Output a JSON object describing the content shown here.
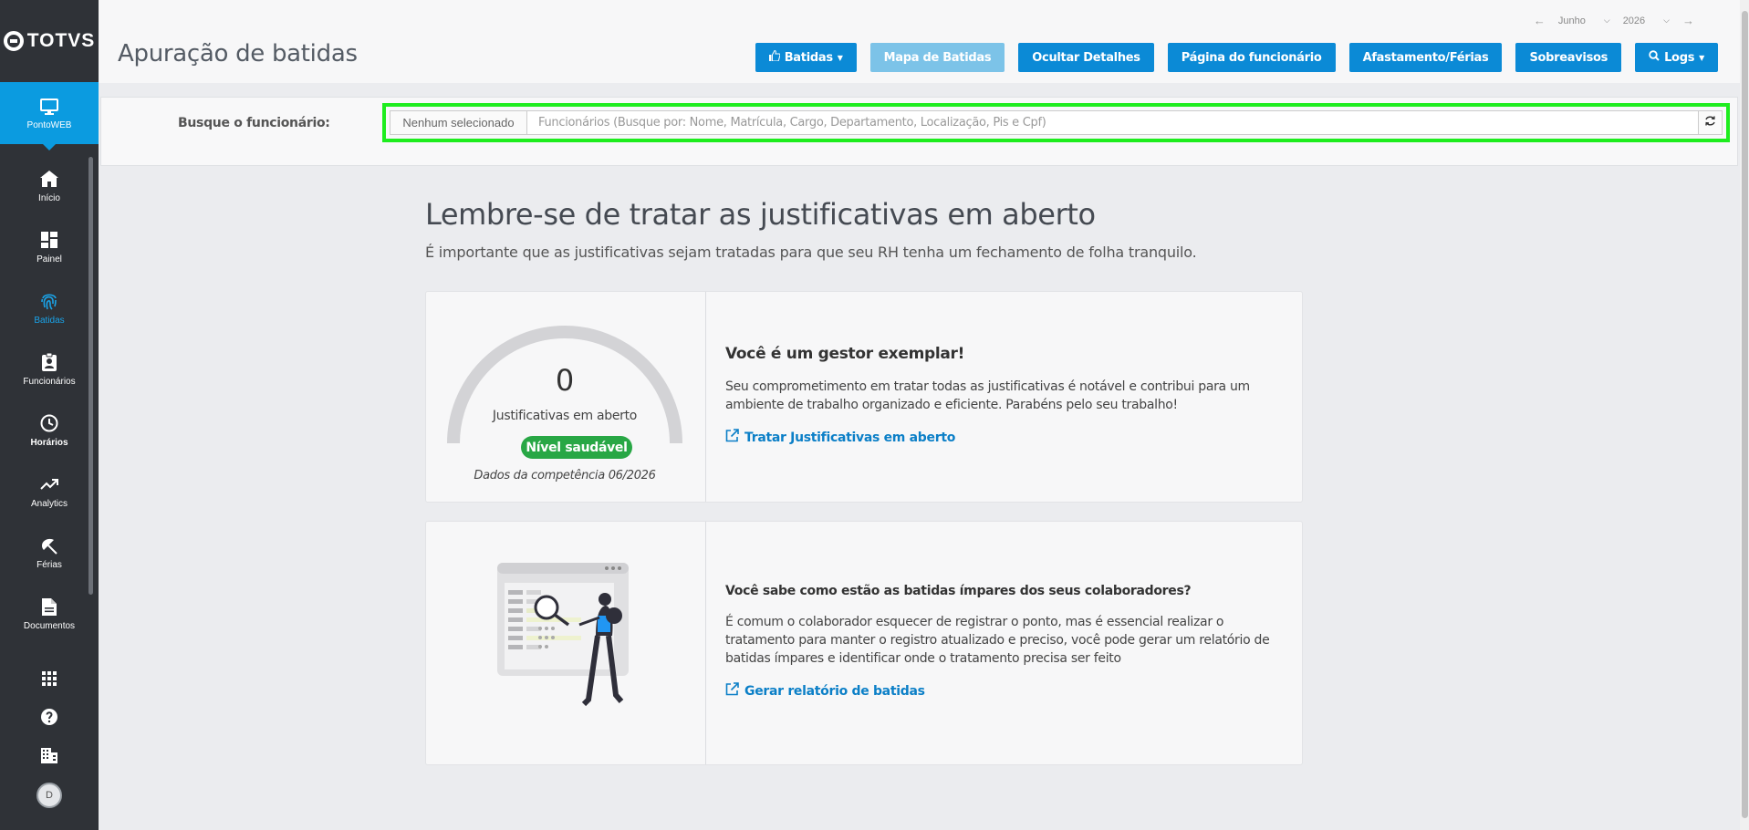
{
  "brand": {
    "name": "TOTVS"
  },
  "sidebar": {
    "app": {
      "label": "PontoWEB",
      "icon": "monitor-icon"
    },
    "items": [
      {
        "label": "Início",
        "icon": "home-icon"
      },
      {
        "label": "Painel",
        "icon": "dashboard-icon"
      },
      {
        "label": "Batidas",
        "icon": "fingerprint-icon"
      },
      {
        "label": "Funcionários",
        "icon": "badge-icon"
      },
      {
        "label": "Horários",
        "icon": "clock-icon"
      },
      {
        "label": "Analytics",
        "icon": "trending-icon"
      },
      {
        "label": "Férias",
        "icon": "umbrella-icon"
      },
      {
        "label": "Documentos",
        "icon": "document-icon"
      }
    ],
    "bottom": {
      "avatar_initial": "D"
    }
  },
  "header": {
    "title": "Apuração de batidas",
    "month": "Junho",
    "year": "2026",
    "buttons": {
      "batidas": "Batidas",
      "mapa": "Mapa de Batidas",
      "ocultar": "Ocultar Detalhes",
      "pagina": "Página do funcionário",
      "afastamento": "Afastamento/Férias",
      "sobreavisos": "Sobreavisos",
      "logs": "Logs"
    }
  },
  "search": {
    "label": "Busque o funcionário:",
    "selected": "Nenhum selecionado",
    "placeholder": "Funcionários (Busque por: Nome, Matrícula, Cargo, Departamento, Localização, Pis e Cpf)"
  },
  "main": {
    "title": "Lembre-se de tratar as justificativas em aberto",
    "subtitle": "É importante que as justificativas sejam tratadas para que seu RH tenha um fechamento de folha tranquilo."
  },
  "card1": {
    "gauge_value": "0",
    "gauge_label": "Justificativas em aberto",
    "badge": "Nível saudável",
    "note": "Dados da competência 06/2026",
    "heading": "Você é um gestor exemplar!",
    "text": "Seu comprometimento em tratar todas as justificativas é notável e contribui para um ambiente de trabalho organizado e eficiente. Parabéns pelo seu trabalho!",
    "link": "Tratar Justificativas em aberto"
  },
  "card2": {
    "heading": "Você sabe como estão as batidas ímpares dos seus colaboradores?",
    "text": "É comum o colaborador esquecer de registrar o ponto, mas é essencial realizar o tratamento para manter o registro atualizado e preciso, você pode gerar um relatório de batidas ímpares e identificar onde o tratamento precisa ser feito",
    "link": "Gerar relatório de batidas"
  },
  "colors": {
    "accent": "#0b8ad6",
    "sidebar": "#2f3237",
    "success": "#28a745",
    "highlight": "#1eed1e"
  }
}
